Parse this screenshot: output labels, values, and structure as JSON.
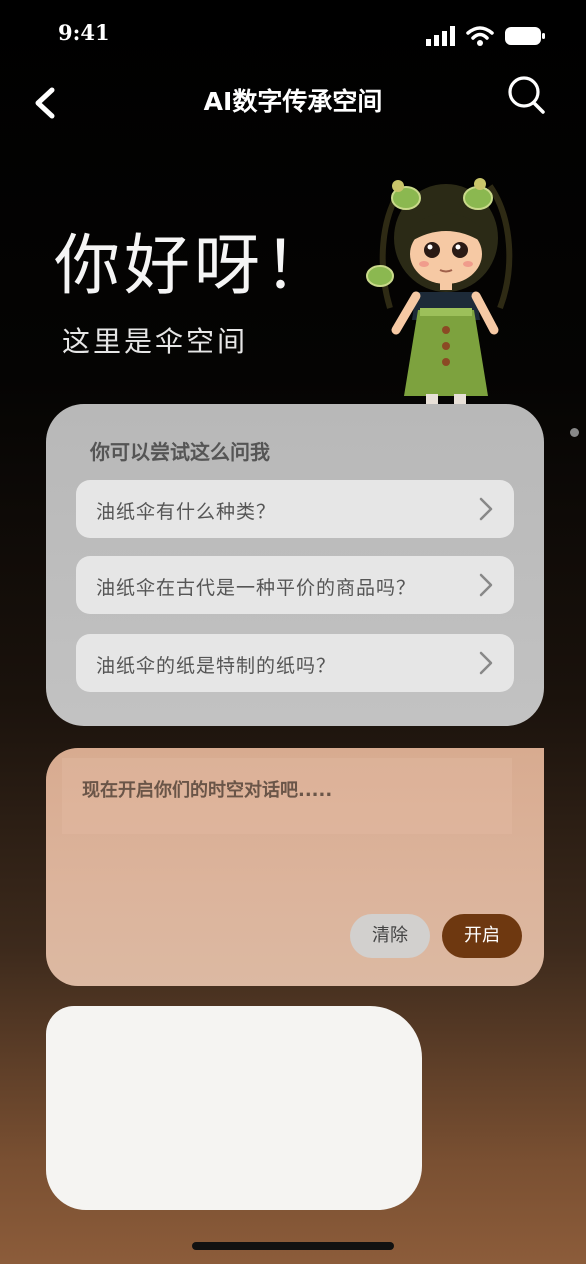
{
  "status_bar": {
    "time": "9:41"
  },
  "nav": {
    "title": "AI数字传承空间",
    "back_icon": "chevron-left-icon",
    "search_icon": "search-icon"
  },
  "hero": {
    "greeting": "你好呀！",
    "subtitle": "这里是伞空间"
  },
  "suggestions": {
    "title": "你可以尝试这么问我",
    "items": [
      {
        "label": "油纸伞有什么种类？"
      },
      {
        "label": "油纸伞在古代是一种平价的商品吗？"
      },
      {
        "label": "油纸伞的纸是特制的纸吗？"
      }
    ]
  },
  "chat": {
    "placeholder": "现在开启你们的时空对话吧.....",
    "clear_label": "清除",
    "start_label": "开启"
  },
  "colors": {
    "accent": "#6e3810",
    "suggest_bg": "#bcbcbc",
    "chat_bg": "#dab09a"
  }
}
